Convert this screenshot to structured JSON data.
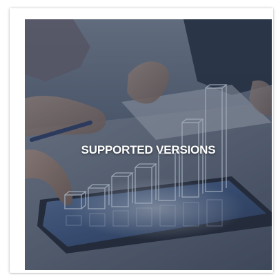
{
  "tile": {
    "title": "SUPPORTED VERSIONS",
    "overlay_color": "#2f3a4d",
    "glow_color": "#cfe6ff"
  }
}
